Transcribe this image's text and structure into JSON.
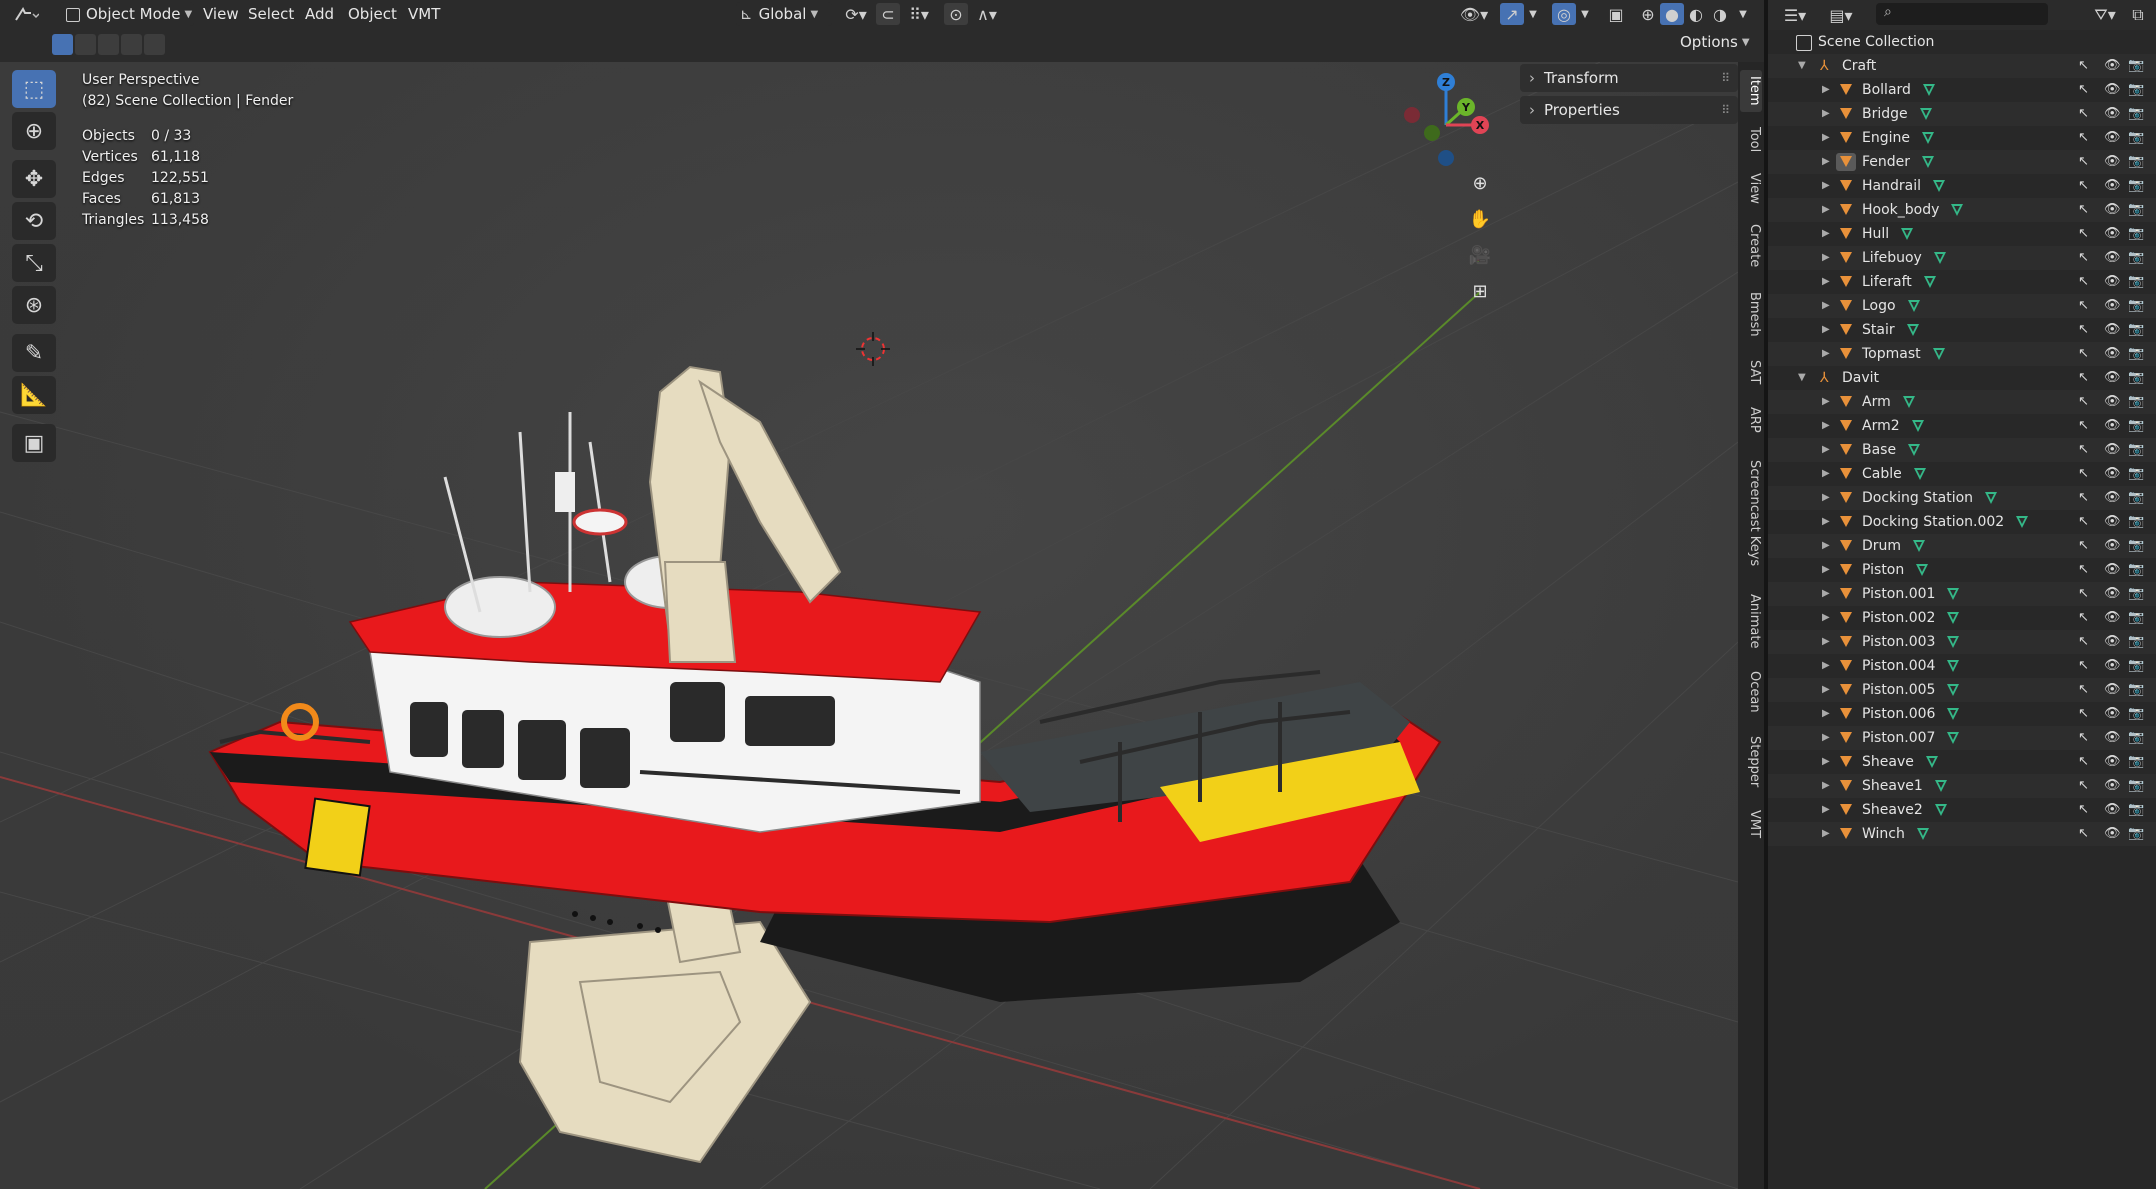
{
  "header": {
    "mode": "Object Mode",
    "menus": [
      "View",
      "Select",
      "Add",
      "Object",
      "VMT"
    ],
    "transform_orientation": "Global",
    "options_label": "Options"
  },
  "overlay": {
    "perspective": "User Perspective",
    "collection_path": "(82) Scene Collection | Fender",
    "stats": [
      {
        "label": "Objects",
        "value": "0 / 33"
      },
      {
        "label": "Vertices",
        "value": "61,118"
      },
      {
        "label": "Edges",
        "value": "122,551"
      },
      {
        "label": "Faces",
        "value": "61,813"
      },
      {
        "label": "Triangles",
        "value": "113,458"
      }
    ]
  },
  "gizmo": {
    "z": "Z",
    "y": "Y",
    "x": "X"
  },
  "npanel": {
    "sections": [
      "Transform",
      "Properties"
    ],
    "tabs": [
      "Item",
      "Tool",
      "View",
      "Create",
      "Bmesh",
      "SAT",
      "ARP",
      "Screencast Keys",
      "Animate",
      "Ocean",
      "Stepper",
      "VMT"
    ]
  },
  "outliner": {
    "root": "Scene Collection",
    "collections": [
      {
        "name": "Craft",
        "objects": [
          "Bollard",
          "Bridge",
          "Engine",
          "Fender",
          "Handrail",
          "Hook_body",
          "Hull",
          "Lifebuoy",
          "Liferaft",
          "Logo",
          "Stair",
          "Topmast"
        ]
      },
      {
        "name": "Davit",
        "objects": [
          "Arm",
          "Arm2",
          "Base",
          "Cable",
          "Docking Station",
          "Docking Station.002",
          "Drum",
          "Piston",
          "Piston.001",
          "Piston.002",
          "Piston.003",
          "Piston.004",
          "Piston.005",
          "Piston.006",
          "Piston.007",
          "Sheave",
          "Sheave1",
          "Sheave2",
          "Winch"
        ]
      }
    ],
    "active_object": "Fender"
  },
  "colors": {
    "accent": "#4772b3",
    "hull_red": "#e8191c",
    "crane_cream": "#e6dcc0",
    "mesh_green": "#34b888",
    "object_orange": "#e8913a"
  }
}
